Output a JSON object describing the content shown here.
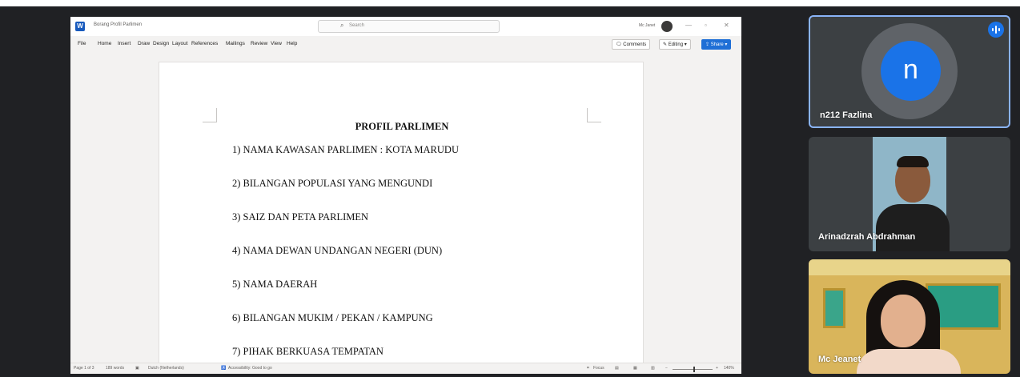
{
  "word": {
    "doc_name": "Borang Profil Parlimen",
    "search_placeholder": "Search",
    "user_name": "Mc Janet",
    "menu": [
      "File",
      "Home",
      "Insert",
      "Draw",
      "Design",
      "Layout",
      "References",
      "Mailings",
      "Review",
      "View",
      "Help"
    ],
    "comments_label": "Comments",
    "editing_label": "Editing",
    "share_label": "Share",
    "document": {
      "heading": "PROFIL PARLIMEN",
      "items": [
        "1)  NAMA KAWASAN PARLIMEN : KOTA MARUDU",
        "2)  BILANGAN POPULASI YANG MENGUNDI",
        "3)  SAIZ DAN PETA PARLIMEN",
        "4)  NAMA DEWAN UNDANGAN NEGERI (DUN)",
        "5)  NAMA DAERAH",
        "6)  BILANGAN MUKIM / PEKAN / KAMPUNG",
        "7)  PIHAK BERKUASA TEMPATAN"
      ]
    },
    "status": {
      "page": "Page 1 of 3",
      "words": "189 words",
      "language": "Dutch (Netherlands)",
      "accessibility": "Accessibility: Good to go",
      "focus": "Focus",
      "zoom": "140%"
    }
  },
  "participants": [
    {
      "name": "n212 Fazlina",
      "initial": "n",
      "avatar_color": "#1a73e8",
      "speaking": true
    },
    {
      "name": "Arinadzrah Abdrahman",
      "speaking": false
    },
    {
      "name": "Mc Jeanet",
      "speaking": false
    }
  ],
  "colors": {
    "meet_background": "#202124",
    "word_accent": "#185abd",
    "active_speaker_border": "#8ab4f8"
  }
}
